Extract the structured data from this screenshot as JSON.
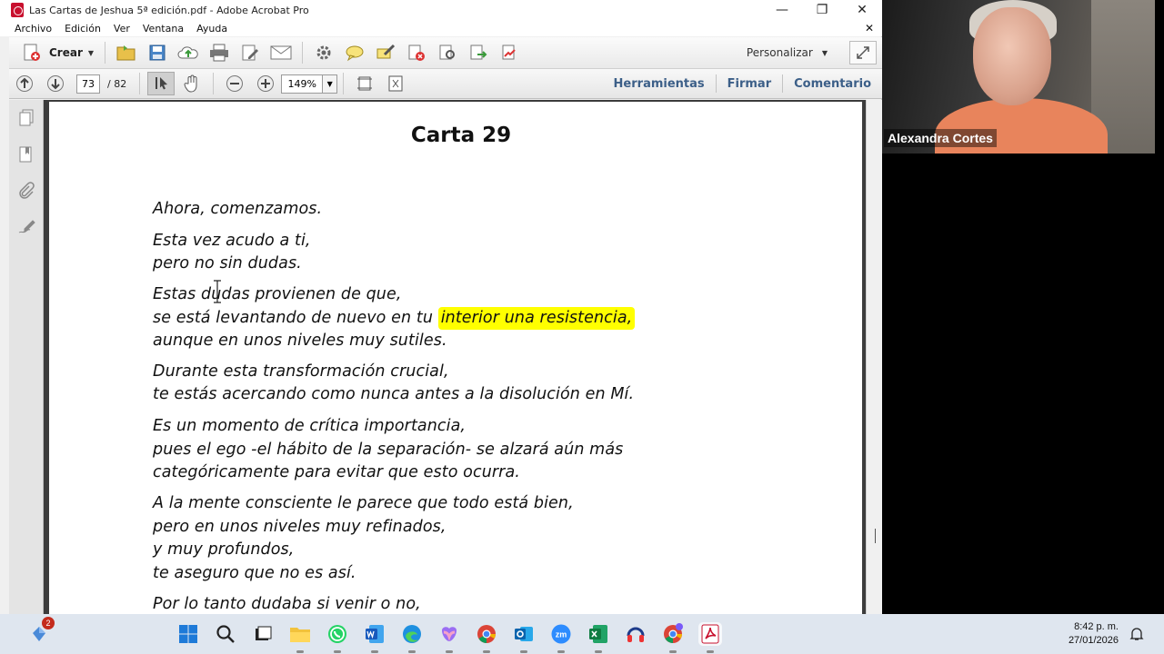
{
  "window": {
    "title": "Las Cartas de Jeshua 5ª edición.pdf - Adobe Acrobat Pro",
    "minimize_glyph": "—",
    "restore_glyph": "❐",
    "close_glyph": "✕"
  },
  "menu": {
    "items": [
      "Archivo",
      "Edición",
      "Ver",
      "Ventana",
      "Ayuda"
    ],
    "close_doc_glyph": "✕"
  },
  "toolbar": {
    "crear_label": "Crear",
    "personalizar_label": "Personalizar",
    "icons": [
      "crear-icon",
      "open-folder-icon",
      "save-icon",
      "cloud-upload-icon",
      "print-icon",
      "edit-icon",
      "email-icon",
      "gear-icon",
      "comment-bubble-icon",
      "highlight-pen-icon",
      "stop-form-icon",
      "stamp-icon",
      "export-icon",
      "sign-icon"
    ]
  },
  "navigation": {
    "current_page": "73",
    "total_pages": "/ 82",
    "zoom": "149%",
    "links": [
      "Herramientas",
      "Firmar",
      "Comentario"
    ]
  },
  "document": {
    "heading": "Carta 29",
    "lines": {
      "l1": "Ahora, comenzamos.",
      "l2": "Esta vez acudo a ti,",
      "l3": "pero no sin dudas.",
      "l4": "Estas dudas provienen de que,",
      "l5a": "se está levantando de nuevo en tu ",
      "l5b": "interior una resistencia,",
      "l6": "aunque en unos niveles muy sutiles.",
      "l7": "Durante esta transformación crucial,",
      "l8": "te estás acercando como nunca antes a la disolución en Mí.",
      "l9": "Es un momento de crítica importancia,",
      "l10": "pues el ego -el hábito de la separación- se alzará aún más",
      "l11": "categóricamente para evitar que esto ocurra.",
      "l12": "A la mente consciente le parece que todo está bien,",
      "l13": "pero en unos niveles muy refinados,",
      "l14": "y muy profundos,",
      "l15": "te aseguro que no es así.",
      "l16": "Por lo tanto dudaba si venir o no,"
    },
    "highlight_color": "#ffff00"
  },
  "video": {
    "participant_name": "Alexandra Cortes"
  },
  "taskbar": {
    "notification_count": "2",
    "apps": [
      "start-icon",
      "search-icon",
      "task-view-icon",
      "file-explorer-icon",
      "whatsapp-icon",
      "word-icon",
      "edge-icon",
      "copilot-icon",
      "chrome-icon",
      "outlook-icon",
      "zoom-icon",
      "excel-icon",
      "audio-icon",
      "chrome-profile-icon",
      "acrobat-icon"
    ],
    "time": "8:42 p. m.",
    "date": "27/01/2026"
  }
}
